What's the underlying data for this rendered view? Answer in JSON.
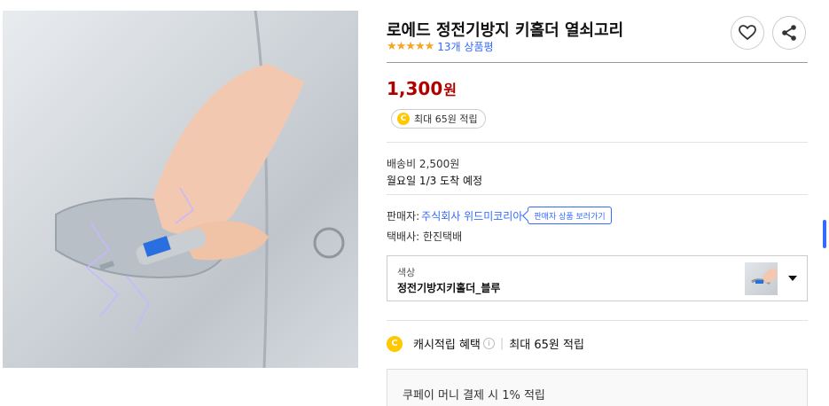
{
  "product": {
    "title": "로에드 정전기방지 키홀더 열쇠고리",
    "stars": "★★★★★",
    "review_count": "13개 상품평",
    "rating_out_of_5": 5
  },
  "price": {
    "amount": "1,300",
    "currency": "원"
  },
  "cash_pill": {
    "coin_letter": "C",
    "text": "최대 65원 적립"
  },
  "shipping": {
    "fee": "배송비 2,500원",
    "arrival": "월요일 1/3 도착 예정"
  },
  "seller": {
    "label": "판매자:",
    "name": "주식회사 위드미코리아",
    "button": "판매자 상품 보러가기",
    "courier": "택배사: 한진택배"
  },
  "option": {
    "label": "색상",
    "value": "정전기방지키홀더_블루"
  },
  "cash_benefit": {
    "coin_letter": "C",
    "label": "캐시적립 혜택",
    "info_glyph": "i",
    "separator": "|",
    "detail": "최대 65원 적립"
  },
  "coupay": {
    "text": "쿠페이 머니 결제 시 1% 적립"
  },
  "colors": {
    "price": "#ae0000",
    "link": "#346aff",
    "star": "#f5a623",
    "coin": "#ffc800"
  }
}
